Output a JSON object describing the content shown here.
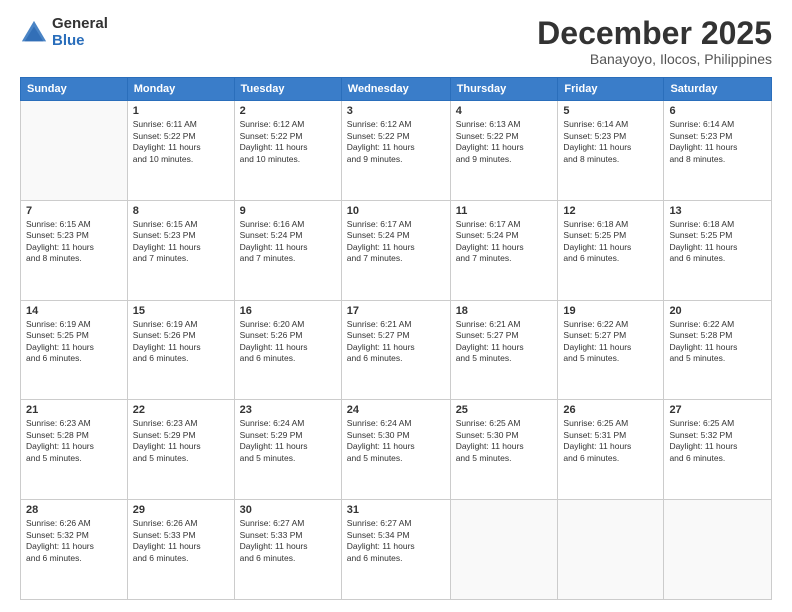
{
  "logo": {
    "general": "General",
    "blue": "Blue"
  },
  "header": {
    "month": "December 2025",
    "location": "Banayoyo, Ilocos, Philippines"
  },
  "days_of_week": [
    "Sunday",
    "Monday",
    "Tuesday",
    "Wednesday",
    "Thursday",
    "Friday",
    "Saturday"
  ],
  "weeks": [
    [
      {
        "day": "",
        "info": ""
      },
      {
        "day": "1",
        "info": "Sunrise: 6:11 AM\nSunset: 5:22 PM\nDaylight: 11 hours\nand 10 minutes."
      },
      {
        "day": "2",
        "info": "Sunrise: 6:12 AM\nSunset: 5:22 PM\nDaylight: 11 hours\nand 10 minutes."
      },
      {
        "day": "3",
        "info": "Sunrise: 6:12 AM\nSunset: 5:22 PM\nDaylight: 11 hours\nand 9 minutes."
      },
      {
        "day": "4",
        "info": "Sunrise: 6:13 AM\nSunset: 5:22 PM\nDaylight: 11 hours\nand 9 minutes."
      },
      {
        "day": "5",
        "info": "Sunrise: 6:14 AM\nSunset: 5:23 PM\nDaylight: 11 hours\nand 8 minutes."
      },
      {
        "day": "6",
        "info": "Sunrise: 6:14 AM\nSunset: 5:23 PM\nDaylight: 11 hours\nand 8 minutes."
      }
    ],
    [
      {
        "day": "7",
        "info": "Sunrise: 6:15 AM\nSunset: 5:23 PM\nDaylight: 11 hours\nand 8 minutes."
      },
      {
        "day": "8",
        "info": "Sunrise: 6:15 AM\nSunset: 5:23 PM\nDaylight: 11 hours\nand 7 minutes."
      },
      {
        "day": "9",
        "info": "Sunrise: 6:16 AM\nSunset: 5:24 PM\nDaylight: 11 hours\nand 7 minutes."
      },
      {
        "day": "10",
        "info": "Sunrise: 6:17 AM\nSunset: 5:24 PM\nDaylight: 11 hours\nand 7 minutes."
      },
      {
        "day": "11",
        "info": "Sunrise: 6:17 AM\nSunset: 5:24 PM\nDaylight: 11 hours\nand 7 minutes."
      },
      {
        "day": "12",
        "info": "Sunrise: 6:18 AM\nSunset: 5:25 PM\nDaylight: 11 hours\nand 6 minutes."
      },
      {
        "day": "13",
        "info": "Sunrise: 6:18 AM\nSunset: 5:25 PM\nDaylight: 11 hours\nand 6 minutes."
      }
    ],
    [
      {
        "day": "14",
        "info": "Sunrise: 6:19 AM\nSunset: 5:25 PM\nDaylight: 11 hours\nand 6 minutes."
      },
      {
        "day": "15",
        "info": "Sunrise: 6:19 AM\nSunset: 5:26 PM\nDaylight: 11 hours\nand 6 minutes."
      },
      {
        "day": "16",
        "info": "Sunrise: 6:20 AM\nSunset: 5:26 PM\nDaylight: 11 hours\nand 6 minutes."
      },
      {
        "day": "17",
        "info": "Sunrise: 6:21 AM\nSunset: 5:27 PM\nDaylight: 11 hours\nand 6 minutes."
      },
      {
        "day": "18",
        "info": "Sunrise: 6:21 AM\nSunset: 5:27 PM\nDaylight: 11 hours\nand 5 minutes."
      },
      {
        "day": "19",
        "info": "Sunrise: 6:22 AM\nSunset: 5:27 PM\nDaylight: 11 hours\nand 5 minutes."
      },
      {
        "day": "20",
        "info": "Sunrise: 6:22 AM\nSunset: 5:28 PM\nDaylight: 11 hours\nand 5 minutes."
      }
    ],
    [
      {
        "day": "21",
        "info": "Sunrise: 6:23 AM\nSunset: 5:28 PM\nDaylight: 11 hours\nand 5 minutes."
      },
      {
        "day": "22",
        "info": "Sunrise: 6:23 AM\nSunset: 5:29 PM\nDaylight: 11 hours\nand 5 minutes."
      },
      {
        "day": "23",
        "info": "Sunrise: 6:24 AM\nSunset: 5:29 PM\nDaylight: 11 hours\nand 5 minutes."
      },
      {
        "day": "24",
        "info": "Sunrise: 6:24 AM\nSunset: 5:30 PM\nDaylight: 11 hours\nand 5 minutes."
      },
      {
        "day": "25",
        "info": "Sunrise: 6:25 AM\nSunset: 5:30 PM\nDaylight: 11 hours\nand 5 minutes."
      },
      {
        "day": "26",
        "info": "Sunrise: 6:25 AM\nSunset: 5:31 PM\nDaylight: 11 hours\nand 6 minutes."
      },
      {
        "day": "27",
        "info": "Sunrise: 6:25 AM\nSunset: 5:32 PM\nDaylight: 11 hours\nand 6 minutes."
      }
    ],
    [
      {
        "day": "28",
        "info": "Sunrise: 6:26 AM\nSunset: 5:32 PM\nDaylight: 11 hours\nand 6 minutes."
      },
      {
        "day": "29",
        "info": "Sunrise: 6:26 AM\nSunset: 5:33 PM\nDaylight: 11 hours\nand 6 minutes."
      },
      {
        "day": "30",
        "info": "Sunrise: 6:27 AM\nSunset: 5:33 PM\nDaylight: 11 hours\nand 6 minutes."
      },
      {
        "day": "31",
        "info": "Sunrise: 6:27 AM\nSunset: 5:34 PM\nDaylight: 11 hours\nand 6 minutes."
      },
      {
        "day": "",
        "info": ""
      },
      {
        "day": "",
        "info": ""
      },
      {
        "day": "",
        "info": ""
      }
    ]
  ]
}
